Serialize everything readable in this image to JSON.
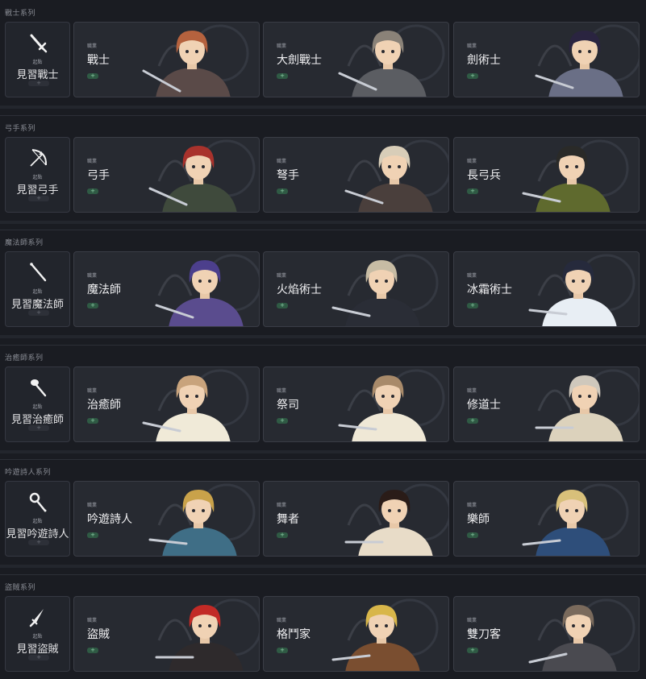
{
  "sections": [
    {
      "header": "戰士系列",
      "base": {
        "tag": "起點",
        "name": "見習戰士",
        "plus": "+",
        "icon": "sword-icon"
      },
      "jobs": [
        {
          "tag": "職業",
          "name": "戰士",
          "plus": "+",
          "hair": "#b5623e",
          "outfit": "#5a4a48"
        },
        {
          "tag": "職業",
          "name": "大劍戰士",
          "plus": "+",
          "hair": "#8a8278",
          "outfit": "#5b5d62"
        },
        {
          "tag": "職業",
          "name": "劍術士",
          "plus": "+",
          "hair": "#2a2440",
          "outfit": "#6a6f86"
        }
      ]
    },
    {
      "header": "弓手系列",
      "base": {
        "tag": "起點",
        "name": "見習弓手",
        "plus": "+",
        "icon": "bow-icon"
      },
      "jobs": [
        {
          "tag": "職業",
          "name": "弓手",
          "plus": "+",
          "hair": "#a8322c",
          "outfit": "#3f4a3c"
        },
        {
          "tag": "職業",
          "name": "弩手",
          "plus": "+",
          "hair": "#d8cdb8",
          "outfit": "#4a3f3c"
        },
        {
          "tag": "職業",
          "name": "長弓兵",
          "plus": "+",
          "hair": "#2a2a28",
          "outfit": "#5f6a2e"
        }
      ]
    },
    {
      "header": "魔法師系列",
      "base": {
        "tag": "起點",
        "name": "見習魔法師",
        "plus": "+",
        "icon": "staff-icon"
      },
      "jobs": [
        {
          "tag": "職業",
          "name": "魔法師",
          "plus": "+",
          "hair": "#4c3f8c",
          "outfit": "#5a4c8e"
        },
        {
          "tag": "職業",
          "name": "火焰術士",
          "plus": "+",
          "hair": "#c7bca4",
          "outfit": "#2a2d36"
        },
        {
          "tag": "職業",
          "name": "冰霜術士",
          "plus": "+",
          "hair": "#262a3c",
          "outfit": "#e8eef4"
        }
      ]
    },
    {
      "header": "治癒師系列",
      "base": {
        "tag": "起點",
        "name": "見習治癒師",
        "plus": "+",
        "icon": "wand-icon"
      },
      "jobs": [
        {
          "tag": "職業",
          "name": "治癒師",
          "plus": "+",
          "hair": "#c8a37c",
          "outfit": "#f0ead8"
        },
        {
          "tag": "職業",
          "name": "祭司",
          "plus": "+",
          "hair": "#a88a6a",
          "outfit": "#efe8d6"
        },
        {
          "tag": "職業",
          "name": "修道士",
          "plus": "+",
          "hair": "#cfc8bc",
          "outfit": "#dcd2bc"
        }
      ]
    },
    {
      "header": "吟遊詩人系列",
      "base": {
        "tag": "起點",
        "name": "見習吟遊詩人",
        "plus": "+",
        "icon": "rattle-icon"
      },
      "jobs": [
        {
          "tag": "職業",
          "name": "吟遊詩人",
          "plus": "+",
          "hair": "#c9a24a",
          "outfit": "#3f6e86"
        },
        {
          "tag": "職業",
          "name": "舞者",
          "plus": "+",
          "hair": "#2a1c18",
          "outfit": "#e8dcc8"
        },
        {
          "tag": "職業",
          "name": "樂師",
          "plus": "+",
          "hair": "#d8c07a",
          "outfit": "#2e4e7a"
        }
      ]
    },
    {
      "header": "盜賊系列",
      "base": {
        "tag": "起點",
        "name": "見習盜賊",
        "plus": "+",
        "icon": "dagger-icon"
      },
      "jobs": [
        {
          "tag": "職業",
          "name": "盜賊",
          "plus": "+",
          "hair": "#c22a26",
          "outfit": "#2e2a2c"
        },
        {
          "tag": "職業",
          "name": "格鬥家",
          "plus": "+",
          "hair": "#d8b64a",
          "outfit": "#7a4e30"
        },
        {
          "tag": "職業",
          "name": "雙刀客",
          "plus": "+",
          "hair": "#7a6a5c",
          "outfit": "#4a4a50"
        }
      ]
    }
  ]
}
